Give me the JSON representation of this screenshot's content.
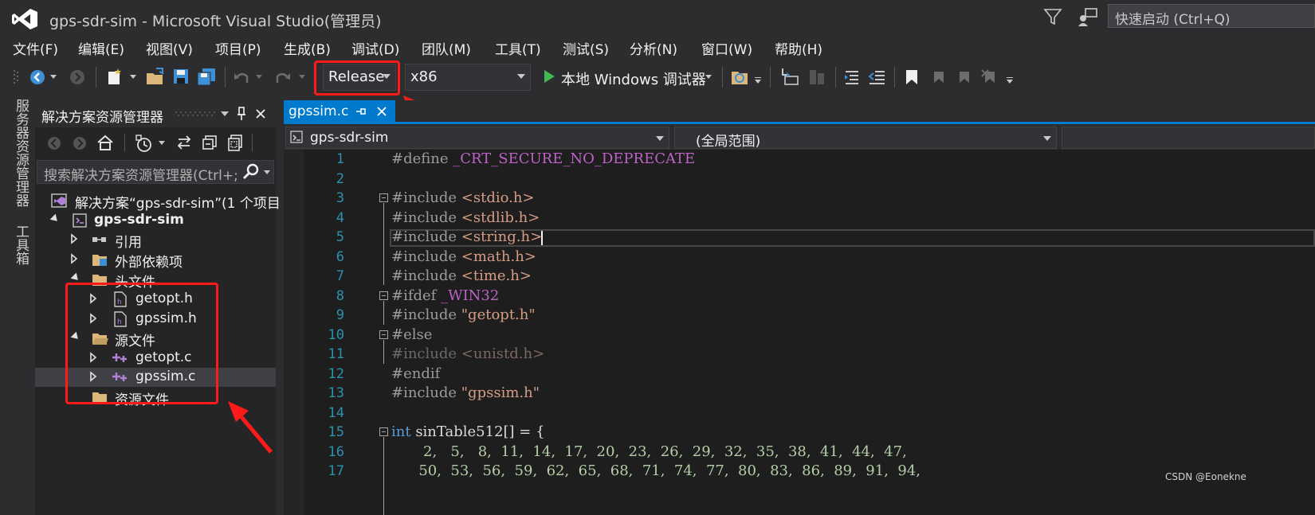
{
  "window": {
    "title": "gps-sdr-sim - Microsoft Visual Studio(管理员)",
    "quick_launch_placeholder": "快速启动 (Ctrl+Q)"
  },
  "menu": [
    "文件(F)",
    "编辑(E)",
    "视图(V)",
    "项目(P)",
    "生成(B)",
    "调试(D)",
    "团队(M)",
    "工具(T)",
    "测试(S)",
    "分析(N)",
    "窗口(W)",
    "帮助(H)"
  ],
  "toolbar": {
    "configuration": "Release",
    "platform": "x86",
    "debugger": "本地 Windows 调试器"
  },
  "side_tabs": [
    "服务器资源管理器",
    "工具箱"
  ],
  "solution_explorer": {
    "title": "解决方案资源管理器",
    "search_placeholder": "搜索解决方案资源管理器(Ctrl+;",
    "tree": [
      {
        "label": "解决方案“gps-sdr-sim”(1 个项目",
        "level": 0
      },
      {
        "label": "gps-sdr-sim",
        "level": 1,
        "bold": true
      },
      {
        "label": "引用",
        "level": 2
      },
      {
        "label": "外部依赖项",
        "level": 2
      },
      {
        "label": "头文件",
        "level": 2
      },
      {
        "label": "getopt.h",
        "level": 3
      },
      {
        "label": "gpssim.h",
        "level": 3
      },
      {
        "label": "源文件",
        "level": 2
      },
      {
        "label": "getopt.c",
        "level": 3
      },
      {
        "label": "gpssim.c",
        "level": 3,
        "selected": true
      },
      {
        "label": "资源文件",
        "level": 2
      }
    ]
  },
  "editor": {
    "tab_label": "gpssim.c",
    "nav_project": "gps-sdr-sim",
    "nav_scope": "(全局范围)",
    "lines": [
      {
        "n": "1",
        "parts": [
          [
            "#define ",
            "#9b9b9b"
          ],
          [
            "_CRT_SECURE_NO_DEPRECATE",
            "#bd63c5"
          ]
        ]
      },
      {
        "n": "2",
        "parts": []
      },
      {
        "n": "3",
        "parts": [
          [
            "#include ",
            "#9b9b9b"
          ],
          [
            "<stdio.h>",
            "#d69d85"
          ]
        ]
      },
      {
        "n": "4",
        "parts": [
          [
            "#include ",
            "#9b9b9b"
          ],
          [
            "<stdlib.h>",
            "#d69d85"
          ]
        ]
      },
      {
        "n": "5",
        "parts": [
          [
            "#include ",
            "#9b9b9b"
          ],
          [
            "<string.h>",
            "#d69d85"
          ]
        ]
      },
      {
        "n": "6",
        "parts": [
          [
            "#include ",
            "#9b9b9b"
          ],
          [
            "<math.h>",
            "#d69d85"
          ]
        ]
      },
      {
        "n": "7",
        "parts": [
          [
            "#include ",
            "#9b9b9b"
          ],
          [
            "<time.h>",
            "#d69d85"
          ]
        ]
      },
      {
        "n": "8",
        "parts": [
          [
            "#ifdef ",
            "#9b9b9b"
          ],
          [
            "_WIN32",
            "#bd63c5"
          ]
        ]
      },
      {
        "n": "9",
        "parts": [
          [
            "#include ",
            "#9b9b9b"
          ],
          [
            "\"getopt.h\"",
            "#d69d85"
          ]
        ]
      },
      {
        "n": "10",
        "parts": [
          [
            "#else",
            "#9b9b9b"
          ]
        ]
      },
      {
        "n": "11",
        "parts": [
          [
            "#include ",
            "#6a6a6a"
          ],
          [
            "<unistd.h>",
            "#7a6a62"
          ]
        ]
      },
      {
        "n": "12",
        "parts": [
          [
            "#endif",
            "#9b9b9b"
          ]
        ]
      },
      {
        "n": "13",
        "parts": [
          [
            "#include ",
            "#9b9b9b"
          ],
          [
            "\"gpssim.h\"",
            "#d69d85"
          ]
        ]
      },
      {
        "n": "14",
        "parts": []
      },
      {
        "n": "15",
        "parts": [
          [
            "int",
            "#569cd6"
          ],
          [
            " sinTable512[] = {",
            "#dcdcdc"
          ]
        ]
      },
      {
        "n": "16",
        "parts": [
          [
            "       2,   5,   8,  11,  14,  17,  20,  23,  26,  29,  32,  35,  38,  41,  44,  47,",
            "#b5cea8"
          ]
        ]
      },
      {
        "n": "17",
        "parts": [
          [
            "      50,  53,  56,  59,  62,  65,  68,  71,  74,  77,  80,  83,  86,  89,  91,  94,",
            "#b5cea8"
          ]
        ]
      }
    ]
  },
  "watermark": "CSDN @Eonekne"
}
